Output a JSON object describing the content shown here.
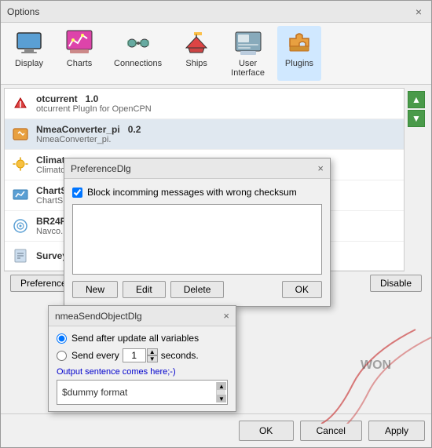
{
  "window": {
    "title": "Options",
    "close_label": "×"
  },
  "toolbar": {
    "items": [
      {
        "id": "display",
        "label": "Display",
        "icon": "🖥"
      },
      {
        "id": "charts",
        "label": "Charts",
        "icon": "📊"
      },
      {
        "id": "connections",
        "label": "Connections",
        "icon": "🔌"
      },
      {
        "id": "ships",
        "label": "Ships",
        "icon": "🚢"
      },
      {
        "id": "user_interface",
        "label": "User\nInterface",
        "icon": "🖱"
      },
      {
        "id": "plugins",
        "label": "Plugins",
        "icon": "🔧",
        "active": true
      }
    ]
  },
  "plugin_list": [
    {
      "id": "otcurrent",
      "name": "otcurrent",
      "version": "1.0",
      "desc": "otcurrent PlugIn for OpenCPN",
      "icon": "⚡"
    },
    {
      "id": "nmea_converter",
      "name": "NmeaConverter_pi",
      "version": "0.2",
      "desc": "NmeaConverter_pi.",
      "icon": "🧩",
      "selected": true
    },
    {
      "id": "climate",
      "name": "Climat...",
      "version": "",
      "desc": "Climato...",
      "icon": "🌤"
    },
    {
      "id": "charts2",
      "name": "ChartS...",
      "version": "",
      "desc": "ChartS...",
      "icon": "📈"
    },
    {
      "id": "br24",
      "name": "BR24R...",
      "version": "",
      "desc": "Navco...",
      "icon": "📡"
    },
    {
      "id": "survey",
      "name": "Survey...",
      "version": "",
      "desc": "",
      "icon": "📋"
    }
  ],
  "plugin_actions": {
    "preferences_label": "Preferences",
    "disable_label": "Disable"
  },
  "bottom_buttons": {
    "ok_label": "OK",
    "cancel_label": "Cancel",
    "apply_label": "Apply"
  },
  "pref_dialog": {
    "title": "PreferenceDlg",
    "close_label": "×",
    "checkbox_label": "Block incomming messages with wrong checksum",
    "checkbox_checked": true,
    "buttons": {
      "new_label": "New",
      "edit_label": "Edit",
      "delete_label": "Delete",
      "ok_label": "OK"
    }
  },
  "nmea_dialog": {
    "title": "nmeaSendObjectDlg",
    "close_label": "×",
    "radio_option1": "Send after update all variables",
    "radio_option2": "Send every",
    "spinner_value": "1",
    "seconds_label": "seconds.",
    "output_label": "Output sentence comes here;-)",
    "format_value": "$dummy format",
    "radio1_checked": true,
    "radio2_checked": false
  },
  "green_arrows": {
    "up": "▲",
    "down": "▼"
  }
}
